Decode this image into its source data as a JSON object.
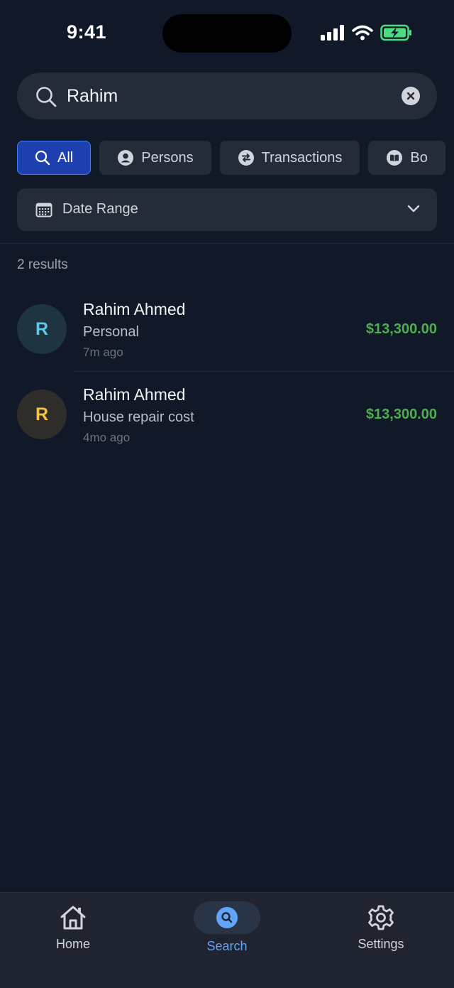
{
  "status": {
    "time": "9:41"
  },
  "search": {
    "value": "Rahim",
    "placeholder": "Search"
  },
  "filters": [
    {
      "label": "All",
      "icon": "search-icon",
      "active": true
    },
    {
      "label": "Persons",
      "icon": "person-icon",
      "active": false
    },
    {
      "label": "Transactions",
      "icon": "exchange-icon",
      "active": false
    },
    {
      "label": "Bo",
      "icon": "book-icon",
      "active": false
    }
  ],
  "date_range": {
    "label": "Date Range"
  },
  "results": {
    "count_text": "2 results",
    "items": [
      {
        "initial": "R",
        "name": "Rahim Ahmed",
        "description": "Personal",
        "time_ago": "7m ago",
        "amount": "$13,300.00",
        "avatar_bg": "#1e3441",
        "avatar_fg": "#5ec8e6"
      },
      {
        "initial": "R",
        "name": "Rahim Ahmed",
        "description": "House repair cost",
        "time_ago": "4mo ago",
        "amount": "$13,300.00",
        "avatar_bg": "#2f2d29",
        "avatar_fg": "#f5c542"
      }
    ]
  },
  "nav": {
    "home": "Home",
    "search": "Search",
    "settings": "Settings"
  },
  "colors": {
    "accent": "#3b82f6",
    "amount": "#4caf50",
    "background": "#111827"
  }
}
